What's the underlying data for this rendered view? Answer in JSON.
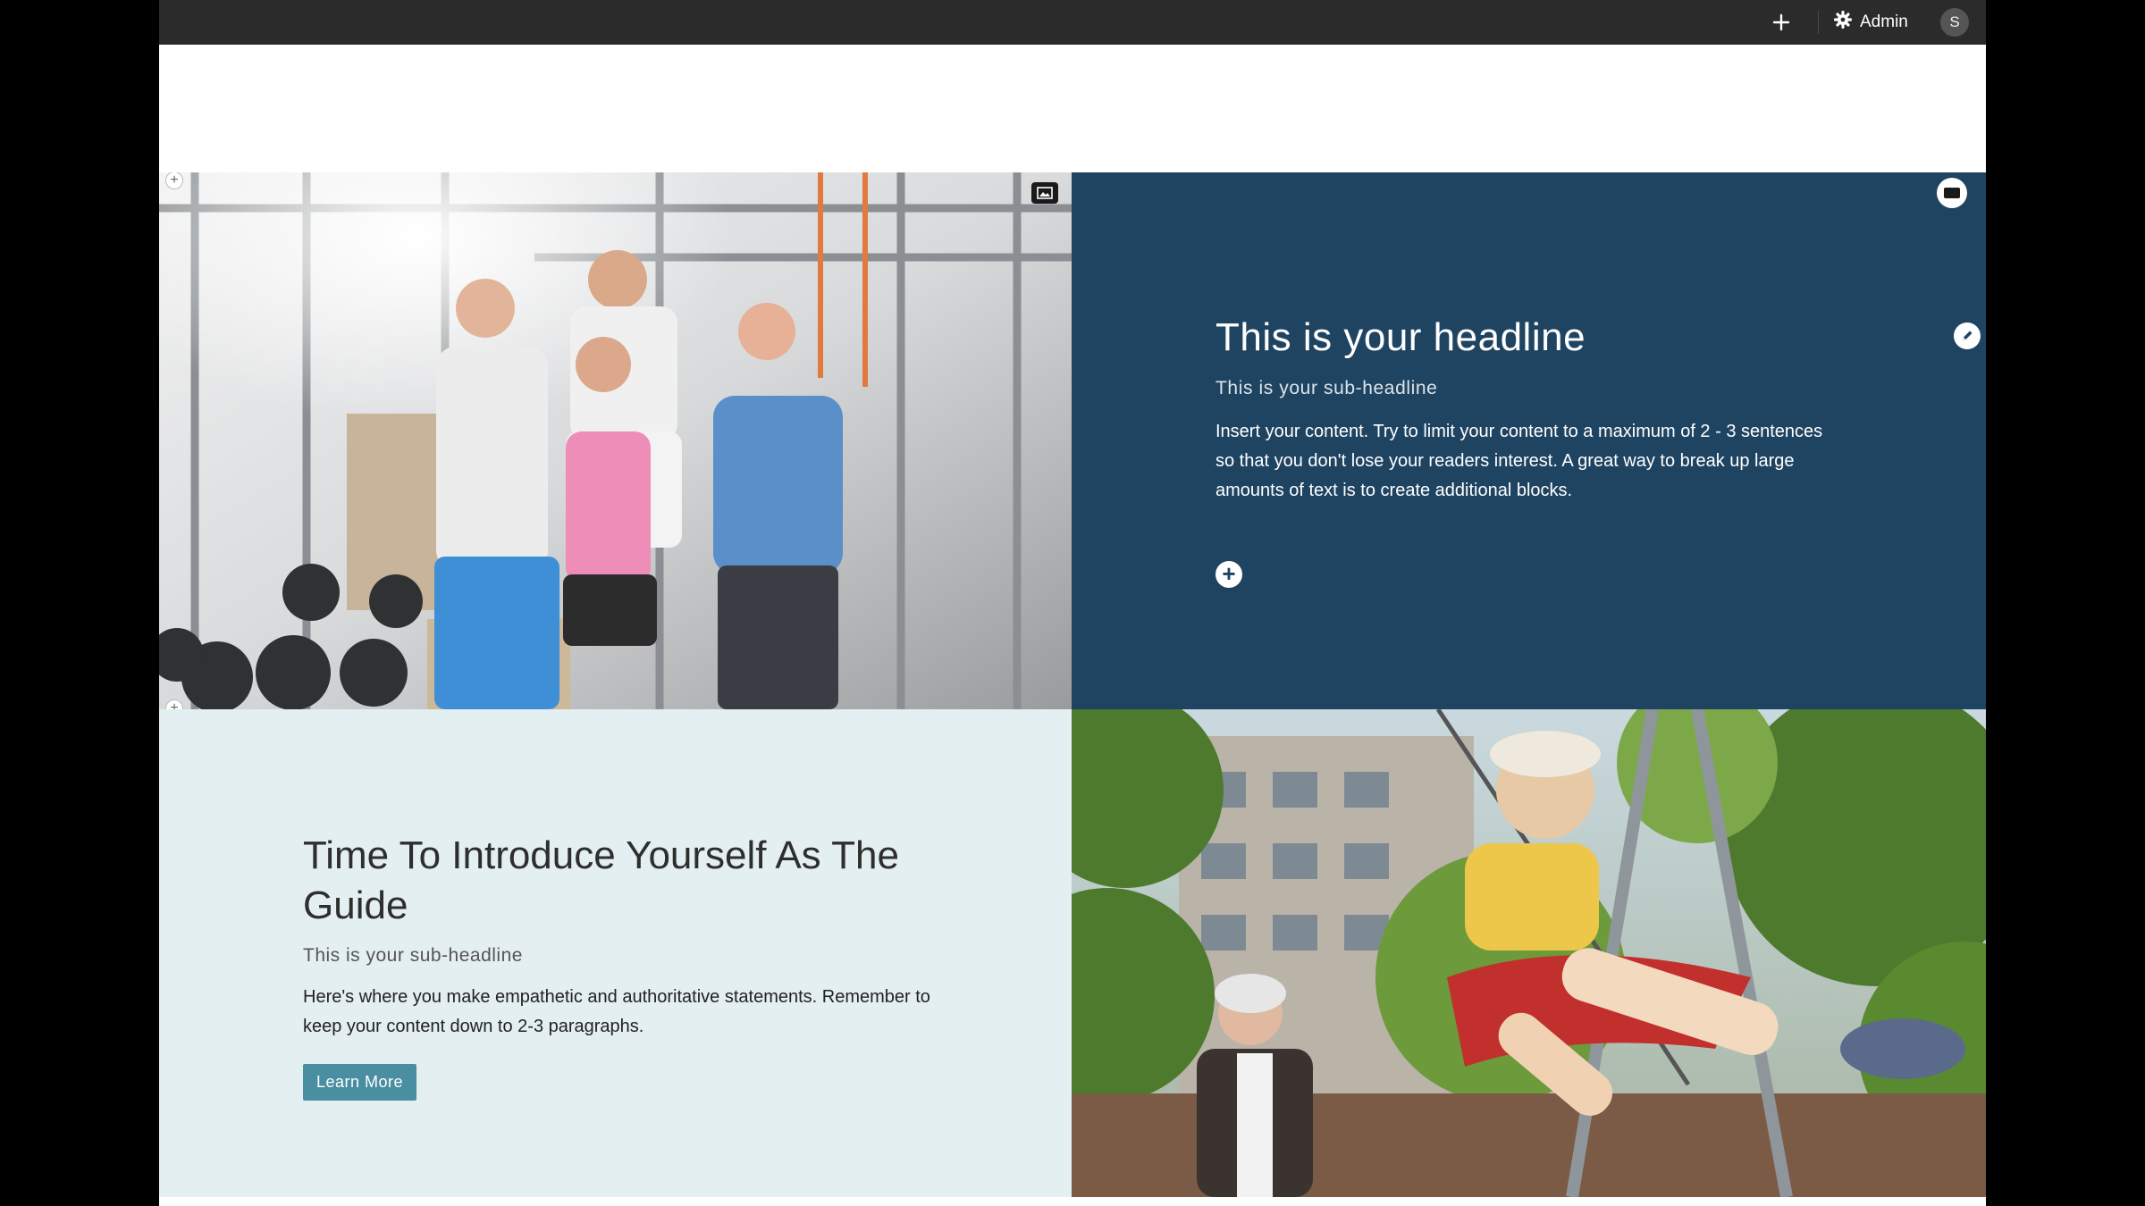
{
  "topbar": {
    "add_icon": "plus-icon",
    "admin_label": "Admin",
    "settings_icon": "gear-icon",
    "avatar_initial": "S"
  },
  "feature_block": {
    "headline": "This is your headline",
    "subheadline": "This is your sub-headline",
    "body": "Insert your content. Try to limit your content to a maximum of 2 - 3 sentences so that you don't lose your readers interest. A great way to break up large amounts of text is to create additional blocks."
  },
  "intro_block": {
    "headline": "Time To Introduce Yourself As The Guide",
    "subheadline": "This is your sub-headline",
    "body": "Here's where you make empathetic and authoritative statements. Remember to keep your content down to 2-3 paragraphs.",
    "button_label": "Learn More"
  },
  "colors": {
    "topbar": "#2b2b2b",
    "feature_bg": "#1f4462",
    "intro_bg": "#e3eff1",
    "button": "#4a8fa1"
  }
}
